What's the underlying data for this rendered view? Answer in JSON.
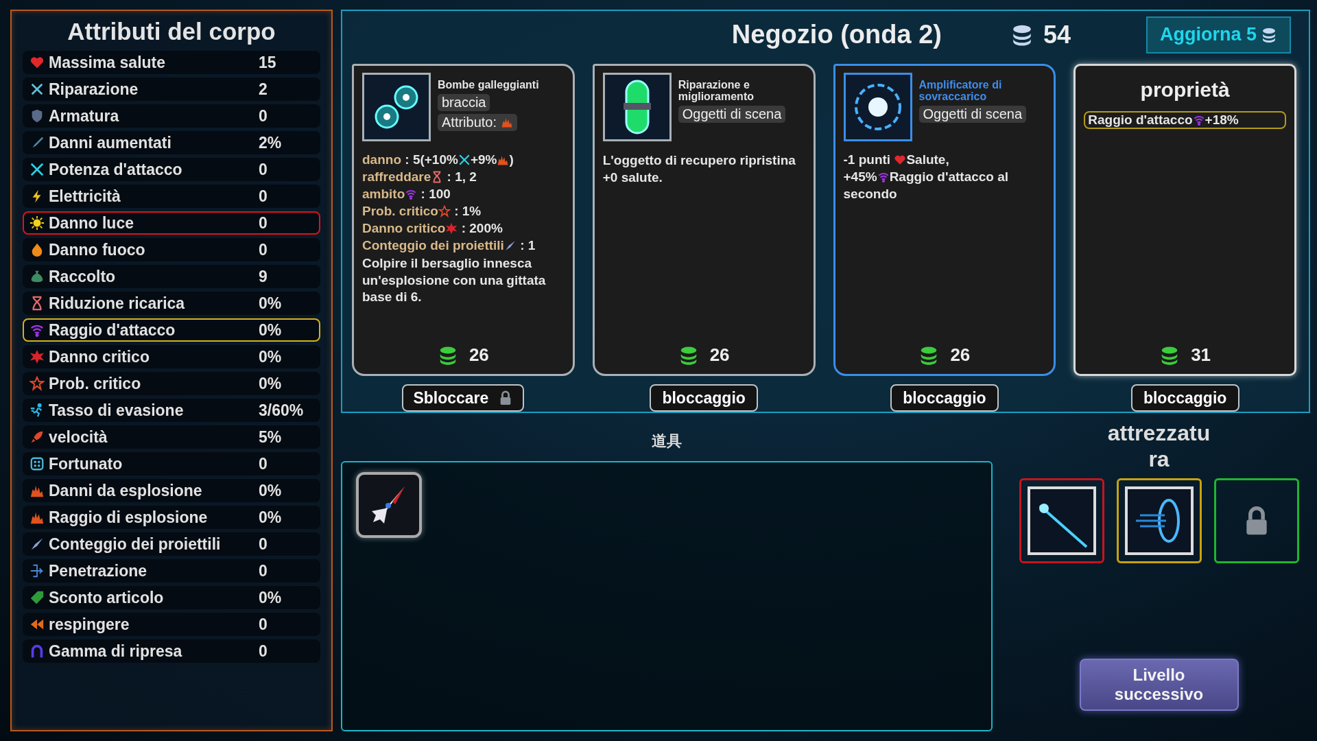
{
  "attributes_panel": {
    "title": "Attributi del corpo",
    "rows": [
      {
        "label": "Massima salute",
        "value": "15",
        "outlined": false
      },
      {
        "label": "Riparazione",
        "value": "2",
        "outlined": false
      },
      {
        "label": "Armatura",
        "value": "0",
        "outlined": false
      },
      {
        "label": "Danni aumentati",
        "value": "2%",
        "outlined": false
      },
      {
        "label": "Potenza d'attacco",
        "value": "0",
        "outlined": false
      },
      {
        "label": "Elettricità",
        "value": "0",
        "outlined": false
      },
      {
        "label": "Danno luce",
        "value": "0",
        "outlined": true,
        "color": "#d8141c"
      },
      {
        "label": "Danno fuoco",
        "value": "0",
        "outlined": false
      },
      {
        "label": "Raccolto",
        "value": "9",
        "outlined": false
      },
      {
        "label": "Riduzione ricarica",
        "value": "0%",
        "outlined": false
      },
      {
        "label": "Raggio d'attacco",
        "value": "0%",
        "outlined": true,
        "color": "#d4b21c"
      },
      {
        "label": "Danno critico",
        "value": "0%",
        "outlined": false
      },
      {
        "label": "Prob. critico",
        "value": "0%",
        "outlined": false
      },
      {
        "label": "Tasso di evasione",
        "value": "3/60%",
        "outlined": false
      },
      {
        "label": "velocità",
        "value": "5%",
        "outlined": false
      },
      {
        "label": "Fortunato",
        "value": "0",
        "outlined": false
      },
      {
        "label": "Danni da esplosione",
        "value": "0%",
        "outlined": false
      },
      {
        "label": "Raggio di esplosione",
        "value": "0%",
        "outlined": false
      },
      {
        "label": "Conteggio dei proiettili",
        "value": "0",
        "outlined": false
      },
      {
        "label": "Penetrazione",
        "value": "0",
        "outlined": false
      },
      {
        "label": "Sconto articolo",
        "value": "0%",
        "outlined": false
      },
      {
        "label": "respingere",
        "value": "0",
        "outlined": false
      },
      {
        "label": "Gamma di ripresa",
        "value": "0",
        "outlined": false
      }
    ]
  },
  "shop": {
    "title": "Negozio (onda 2)",
    "coins": "54",
    "refresh_button": {
      "label": "Aggiorna 5"
    },
    "cards": [
      {
        "kind": "item",
        "rare": false,
        "name": "Bombe galleggianti",
        "tags": [
          {
            "text": "braccia",
            "with_icon": false
          },
          {
            "text": "Attributo:",
            "with_icon": true
          }
        ],
        "lines": [
          [
            {
              "kind": "label",
              "text": "danno"
            },
            {
              "kind": "text",
              "text": " : 5(+10%"
            },
            {
              "kind": "swords"
            },
            {
              "kind": "text",
              "text": "+9%"
            },
            {
              "kind": "blast"
            },
            {
              "kind": "text",
              "text": ")"
            }
          ],
          [
            {
              "kind": "label",
              "text": "raffreddare"
            },
            {
              "kind": "hourglass"
            },
            {
              "kind": "text",
              "text": " : 1, 2"
            }
          ],
          [
            {
              "kind": "label",
              "text": "ambito"
            },
            {
              "kind": "signal"
            },
            {
              "kind": "text",
              "text": " : 100"
            }
          ],
          [
            {
              "kind": "label",
              "text": "Prob. critico"
            },
            {
              "kind": "star"
            },
            {
              "kind": "text",
              "text": " : 1%"
            }
          ],
          [
            {
              "kind": "label",
              "text": "Danno critico"
            },
            {
              "kind": "burst"
            },
            {
              "kind": "text",
              "text": " : 200%"
            }
          ],
          [
            {
              "kind": "label",
              "text": "Conteggio dei proiettili"
            },
            {
              "kind": "bullet"
            },
            {
              "kind": "text",
              "text": " : 1"
            }
          ]
        ],
        "description": "Colpire il bersaglio innesca un'esplosione con una gittata base di 6.",
        "price": "26",
        "button": {
          "label": "Sbloccare",
          "locked": true
        }
      },
      {
        "kind": "item",
        "rare": false,
        "name": "Riparazione e miglioramento",
        "tags": [
          {
            "text": "Oggetti di scena",
            "with_icon": false
          }
        ],
        "description": "L'oggetto di recupero ripristina +0 salute.",
        "price": "26",
        "button": {
          "label": "bloccaggio",
          "locked": false
        }
      },
      {
        "kind": "item",
        "rare": true,
        "name": "Amplificatore di sovraccarico",
        "tags": [
          {
            "text": "Oggetti di scena",
            "with_icon": false
          }
        ],
        "lines": [
          [
            {
              "kind": "text",
              "text": "-1 punti "
            },
            {
              "kind": "heart"
            },
            {
              "kind": "text",
              "text": "Salute,"
            }
          ],
          [
            {
              "kind": "text",
              "text": "+45%"
            },
            {
              "kind": "signal"
            },
            {
              "kind": "text",
              "text": "Raggio d'attacco al"
            }
          ],
          [
            {
              "kind": "text",
              "text": "secondo"
            }
          ]
        ],
        "price": "26",
        "button": {
          "label": "bloccaggio",
          "locked": false
        }
      },
      {
        "kind": "property",
        "title": "proprietà",
        "bonus": [
          {
            "kind": "text",
            "text": "Raggio d'attacco"
          },
          {
            "kind": "signal"
          },
          {
            "kind": "text",
            "text": "+18%"
          }
        ],
        "price": "31",
        "button": {
          "label": "bloccaggio",
          "locked": false
        }
      }
    ]
  },
  "inventory": {
    "title": "道具",
    "items": [
      {
        "kind": "ship"
      }
    ]
  },
  "equipment": {
    "title": "attrezzatura",
    "slots": [
      {
        "kind": "beam",
        "color": "#c8141c"
      },
      {
        "kind": "orb",
        "color": "#c9a20e"
      },
      {
        "kind": "locked",
        "color": "#1fb52f"
      }
    ]
  },
  "next_button": {
    "label": "Livello successivo"
  }
}
